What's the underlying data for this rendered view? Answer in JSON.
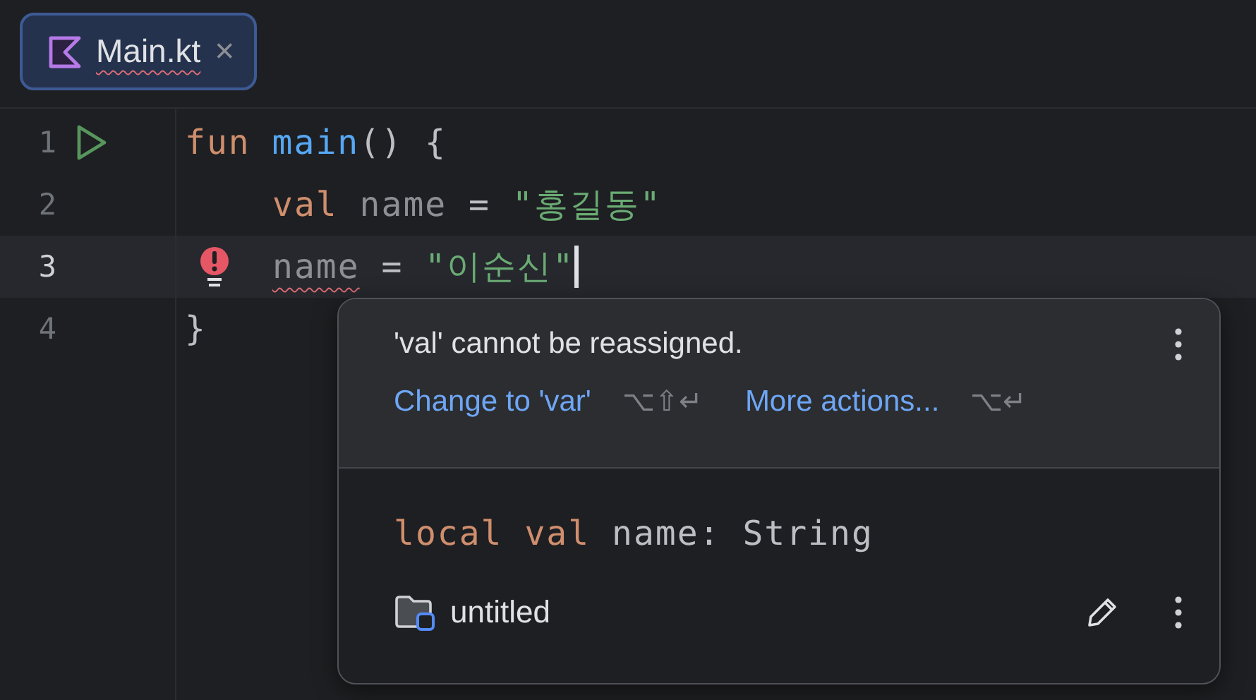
{
  "tabs": [
    {
      "label": "Main.kt",
      "selected": true,
      "error": true,
      "close": "×"
    }
  ],
  "lines": [
    {
      "number": "1",
      "kind": "run",
      "indented": false,
      "current": false,
      "caret": false,
      "tokens": [
        {
          "kind": "keyword",
          "text": "fun "
        },
        {
          "kind": "function",
          "text": "main"
        },
        {
          "kind": "plain",
          "text": "() {"
        }
      ]
    },
    {
      "number": "2",
      "kind": "plain",
      "indented": true,
      "current": false,
      "caret": false,
      "tokens": [
        {
          "kind": "keyword",
          "text": "val "
        },
        {
          "kind": "ident",
          "text": "name"
        },
        {
          "kind": "plain",
          "text": " = "
        },
        {
          "kind": "string",
          "text": "\"홍길동\""
        }
      ]
    },
    {
      "number": "3",
      "kind": "error",
      "indented": true,
      "current": true,
      "caret": true,
      "tokens": [
        {
          "kind": "ident",
          "text": "name",
          "error": true
        },
        {
          "kind": "plain",
          "text": " = "
        },
        {
          "kind": "string",
          "text": "\"이순신\""
        }
      ]
    },
    {
      "number": "4",
      "kind": "plain",
      "indented": false,
      "current": false,
      "caret": false,
      "tokens": [
        {
          "kind": "plain",
          "text": "}"
        }
      ]
    }
  ],
  "popup": {
    "message": "'val' cannot be reassigned.",
    "actions": [
      {
        "label": "Change to 'var'",
        "shortcut": "⌥⇧↵"
      },
      {
        "label": "More actions...",
        "shortcut": "⌥↵"
      }
    ],
    "declaration": [
      {
        "kind": "keyword",
        "text": "local "
      },
      {
        "kind": "keyword",
        "text": "val "
      },
      {
        "kind": "plain",
        "text": "name: String"
      }
    ],
    "module": "untitled"
  }
}
